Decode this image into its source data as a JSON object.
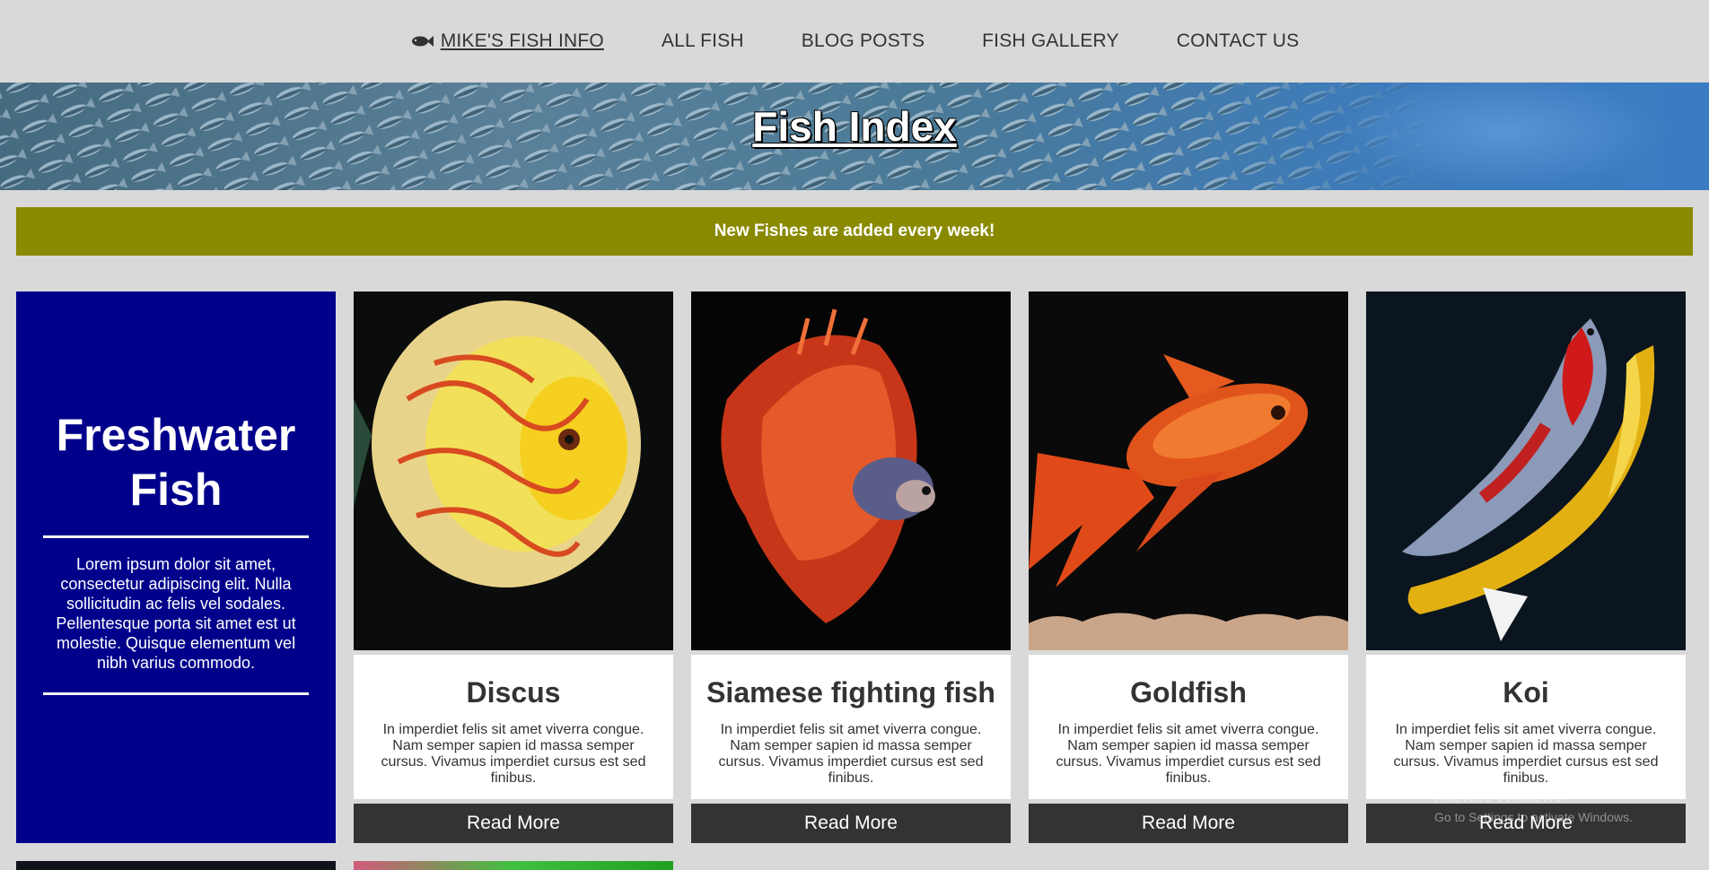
{
  "nav": {
    "brand": "MIKE'S FISH INFO",
    "links": [
      "ALL FISH",
      "BLOG POSTS",
      "FISH GALLERY",
      "CONTACT US"
    ]
  },
  "hero": {
    "title": "Fish Index"
  },
  "banner": {
    "text": "New Fishes are added every week!"
  },
  "intro": {
    "title": "Freshwater Fish",
    "text": "Lorem ipsum dolor sit amet, consectetur adipiscing elit. Nulla sollicitudin ac felis vel sodales. Pellentesque porta sit amet est ut molestie. Quisque elementum vel nibh varius commodo."
  },
  "cards": [
    {
      "title": "Discus",
      "text": "In imperdiet felis sit amet viverra congue. Nam semper sapien id massa semper cursus. Vivamus imperdiet cursus est sed finibus.",
      "button": "Read More"
    },
    {
      "title": "Siamese fighting fish",
      "text": "In imperdiet felis sit amet viverra congue. Nam semper sapien id massa semper cursus. Vivamus imperdiet cursus est sed finibus.",
      "button": "Read More"
    },
    {
      "title": "Goldfish",
      "text": "In imperdiet felis sit amet viverra congue. Nam semper sapien id massa semper cursus. Vivamus imperdiet cursus est sed finibus.",
      "button": "Read More"
    },
    {
      "title": "Koi",
      "text": "In imperdiet felis sit amet viverra congue. Nam semper sapien id massa semper cursus. Vivamus imperdiet cursus est sed finibus.",
      "button": "Read More"
    }
  ],
  "watermark": {
    "title": "Activate Windows",
    "subtitle": "Go to Settings to activate Windows."
  },
  "colors": {
    "banner": "#8a8a00",
    "intro": "#00008b",
    "button": "#333333",
    "background": "#d9d9d9"
  },
  "icons": {
    "brand": "fish-icon"
  }
}
